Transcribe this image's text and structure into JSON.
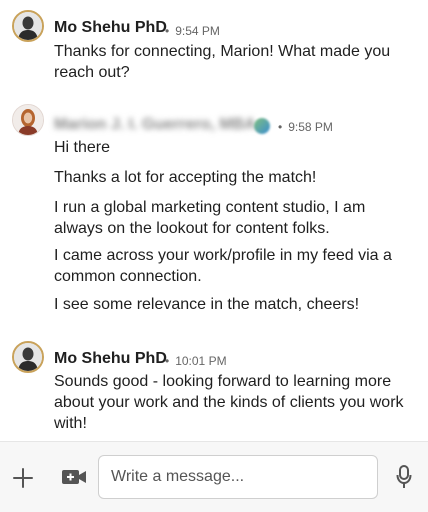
{
  "messages": [
    {
      "sender": "Mo Shehu PhD",
      "time": "9:54 PM",
      "paragraphs": [
        "Thanks for connecting, Marion! What made you reach out?"
      ]
    },
    {
      "sender": "Marion J. I. Guerrero, MBA",
      "time": "9:58 PM",
      "paragraphs": [
        "Hi there",
        "Thanks a lot for accepting the match!",
        "I run a global marketing content studio, I am always on the lookout for content folks.",
        "I came across your work/profile in my feed via a common connection.",
        "I see some relevance in the match, cheers!"
      ]
    },
    {
      "sender": "Mo Shehu PhD",
      "time": "10:01 PM",
      "paragraphs": [
        "Sounds good - looking forward to learning more about your work and the kinds of clients you work with!"
      ]
    }
  ],
  "composer": {
    "placeholder": "Write a message...",
    "icons": [
      "plus-icon",
      "video-icon",
      "microphone-icon"
    ]
  },
  "colors": {
    "avatar_ring": "#c9a25a",
    "text": "#1f1f1f",
    "meta": "#666666"
  }
}
